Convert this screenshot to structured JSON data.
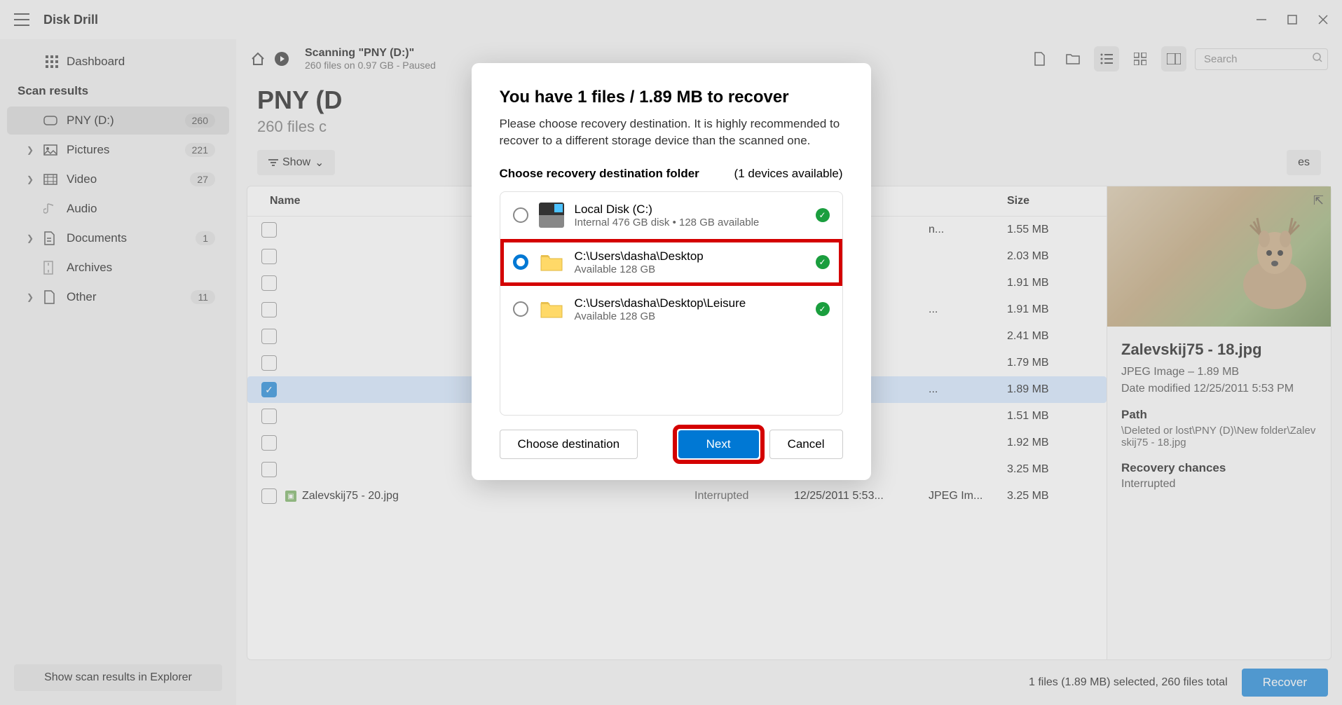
{
  "app": {
    "title": "Disk Drill"
  },
  "sidebar": {
    "dashboard": "Dashboard",
    "section": "Scan results",
    "items": [
      {
        "label": "PNY (D:)",
        "badge": "260",
        "active": true,
        "chev": false
      },
      {
        "label": "Pictures",
        "badge": "221",
        "chev": true
      },
      {
        "label": "Video",
        "badge": "27",
        "chev": true
      },
      {
        "label": "Audio",
        "badge": "",
        "chev": false
      },
      {
        "label": "Documents",
        "badge": "1",
        "chev": true
      },
      {
        "label": "Archives",
        "badge": "",
        "chev": false
      },
      {
        "label": "Other",
        "badge": "11",
        "chev": true
      }
    ],
    "footer_button": "Show scan results in Explorer"
  },
  "toolbar": {
    "scan_title": "Scanning \"PNY (D:)\"",
    "scan_sub": "260 files on 0.97 GB - Paused",
    "search_placeholder": "Search"
  },
  "page": {
    "title": "PNY (D",
    "subtitle": "260 files c"
  },
  "filters": {
    "show": "Show",
    "chances": "es"
  },
  "table": {
    "headers": {
      "name": "Name",
      "size": "Size"
    },
    "rows": [
      {
        "name": "",
        "status": "",
        "date": "",
        "type": "n...",
        "size": "1.55 MB",
        "checked": false
      },
      {
        "name": "",
        "status": "",
        "date": "",
        "type": "",
        "size": "2.03 MB",
        "checked": false
      },
      {
        "name": "",
        "status": "",
        "date": "",
        "type": "",
        "size": "1.91 MB",
        "checked": false
      },
      {
        "name": "",
        "status": "",
        "date": "",
        "type": "...",
        "size": "1.91 MB",
        "checked": false
      },
      {
        "name": "",
        "status": "",
        "date": "",
        "type": "",
        "size": "2.41 MB",
        "checked": false
      },
      {
        "name": "",
        "status": "",
        "date": "",
        "type": "",
        "size": "1.79 MB",
        "checked": false
      },
      {
        "name": "",
        "status": "",
        "date": "",
        "type": "...",
        "size": "1.89 MB",
        "checked": true,
        "selected": true
      },
      {
        "name": "",
        "status": "",
        "date": "",
        "type": "",
        "size": "1.51 MB",
        "checked": false
      },
      {
        "name": "",
        "status": "",
        "date": "",
        "type": "",
        "size": "1.92 MB",
        "checked": false
      },
      {
        "name": "",
        "status": "",
        "date": "",
        "type": "",
        "size": "3.25 MB",
        "checked": false
      },
      {
        "name": "Zalevskij75 - 20.jpg",
        "status": "Interrupted",
        "date": "12/25/2011 5:53...",
        "type": "JPEG Im...",
        "size": "3.25 MB",
        "checked": false,
        "icon": true
      }
    ]
  },
  "preview": {
    "filename": "Zalevskij75 - 18.jpg",
    "meta1": "JPEG Image – 1.89 MB",
    "meta2": "Date modified 12/25/2011 5:53 PM",
    "path_label": "Path",
    "path": "\\Deleted or lost\\PNY (D)\\New folder\\Zalevskij75 - 18.jpg",
    "chances_label": "Recovery chances",
    "chances": "Interrupted"
  },
  "status": {
    "text": "1 files (1.89 MB) selected, 260 files total",
    "recover": "Recover"
  },
  "modal": {
    "title": "You have 1 files / 1.89 MB to recover",
    "desc": "Please choose recovery destination. It is highly recommended to recover to a different storage device than the scanned one.",
    "choose_label": "Choose recovery destination folder",
    "devices_label": "(1 devices available)",
    "destinations": [
      {
        "title": "Local Disk (C:)",
        "sub": "Internal 476 GB disk • 128 GB available",
        "type": "disk",
        "selected": false,
        "highlight": false
      },
      {
        "title": "C:\\Users\\dasha\\Desktop",
        "sub": "Available 128 GB",
        "type": "folder",
        "selected": true,
        "highlight": true
      },
      {
        "title": "C:\\Users\\dasha\\Desktop\\Leisure",
        "sub": "Available 128 GB",
        "type": "folder",
        "selected": false,
        "highlight": false
      }
    ],
    "choose_btn": "Choose destination",
    "next_btn": "Next",
    "cancel_btn": "Cancel"
  }
}
